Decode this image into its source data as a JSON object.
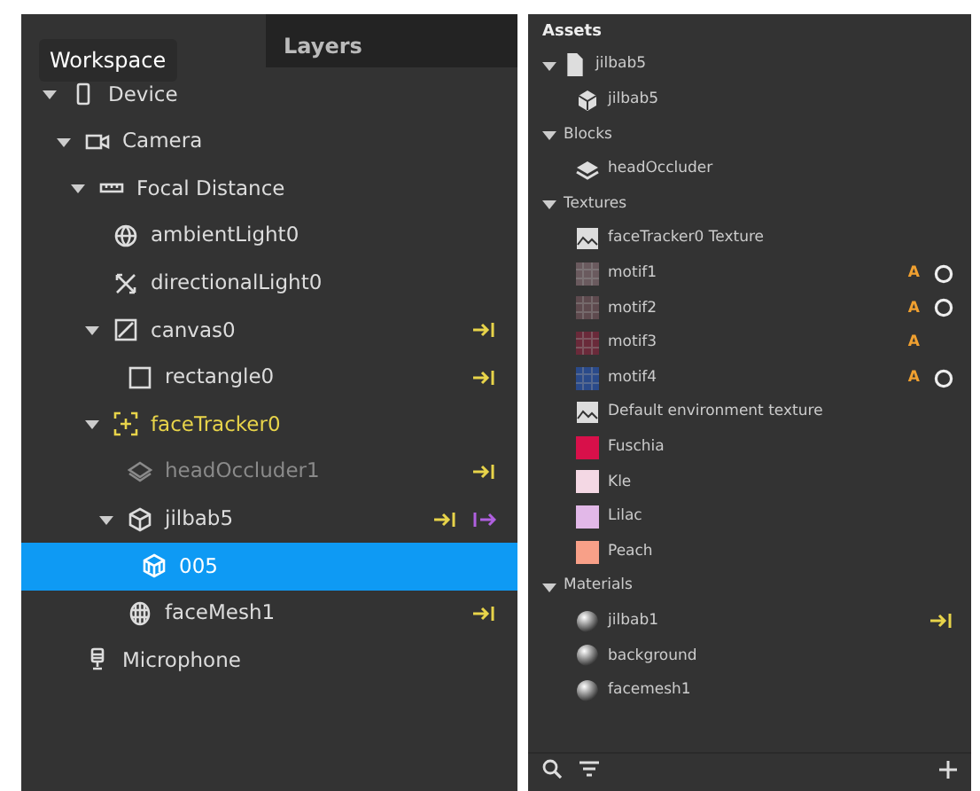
{
  "tooltip": {
    "text": "Workspace"
  },
  "scene_panel": {
    "tabs": [
      {
        "label": "Layers",
        "selected": false
      }
    ],
    "tree": [
      {
        "label": "Device",
        "kind": "device",
        "expanded": true,
        "selected": false,
        "accent": false,
        "dimmed": false,
        "children": [
          {
            "label": "Camera",
            "kind": "camera",
            "expanded": true,
            "selected": false,
            "accent": false,
            "dimmed": false,
            "children": [
              {
                "label": "Focal Distance",
                "kind": "ruler",
                "expanded": true,
                "selected": false,
                "accent": false,
                "dimmed": false,
                "children": [
                  {
                    "label": "ambientLight0",
                    "kind": "globe",
                    "selected": false,
                    "accent": false,
                    "dimmed": false
                  },
                  {
                    "label": "directionalLight0",
                    "kind": "arrows",
                    "selected": false,
                    "accent": false,
                    "dimmed": false
                  },
                  {
                    "label": "canvas0",
                    "kind": "canvas",
                    "expanded": true,
                    "selected": false,
                    "accent": false,
                    "dimmed": false,
                    "link_in": true,
                    "children": [
                      {
                        "label": "rectangle0",
                        "kind": "rectangle",
                        "selected": false,
                        "accent": false,
                        "dimmed": false,
                        "link_in": true
                      }
                    ]
                  },
                  {
                    "label": "faceTracker0",
                    "kind": "tracker",
                    "expanded": true,
                    "selected": false,
                    "accent": true,
                    "dimmed": false,
                    "children": [
                      {
                        "label": "headOccluder1",
                        "kind": "occluder",
                        "selected": false,
                        "accent": false,
                        "dimmed": true,
                        "link_in": true
                      },
                      {
                        "label": "jilbab5",
                        "kind": "object",
                        "expanded": true,
                        "selected": false,
                        "accent": false,
                        "dimmed": false,
                        "link_in": true,
                        "link_out": true,
                        "children": [
                          {
                            "label": "005",
                            "kind": "mesh",
                            "selected": true,
                            "accent": false,
                            "dimmed": false
                          }
                        ]
                      },
                      {
                        "label": "faceMesh1",
                        "kind": "facemesh",
                        "selected": false,
                        "accent": false,
                        "dimmed": false,
                        "link_in": true
                      }
                    ]
                  }
                ]
              }
            ]
          },
          {
            "label": "Microphone",
            "kind": "microphone",
            "selected": false,
            "accent": false,
            "dimmed": false
          }
        ]
      }
    ]
  },
  "assets_panel": {
    "title": "Assets",
    "groups": [
      {
        "label": "jilbab5",
        "kind": "file",
        "expanded": true,
        "items": [
          {
            "label": "jilbab5",
            "kind": "object"
          }
        ]
      },
      {
        "label": "Blocks",
        "kind": "folder",
        "expanded": true,
        "items": [
          {
            "label": "headOccluder",
            "kind": "block"
          }
        ]
      },
      {
        "label": "Textures",
        "kind": "folder",
        "expanded": true,
        "items": [
          {
            "label": "faceTracker0 Texture",
            "kind": "image"
          },
          {
            "label": "motif1",
            "kind": "motif",
            "color": "#6a5a5e",
            "flag": "A",
            "ring": true
          },
          {
            "label": "motif2",
            "kind": "motif",
            "color": "#5e4a4e",
            "flag": "A",
            "ring": true
          },
          {
            "label": "motif3",
            "kind": "motif",
            "color": "#6a2a3a",
            "flag": "A",
            "ring": false
          },
          {
            "label": "motif4",
            "kind": "motif",
            "color": "#2a4a8a",
            "flag": "A",
            "ring": true
          },
          {
            "label": "Default environment texture",
            "kind": "image"
          },
          {
            "label": "Fuschia",
            "kind": "swatch",
            "color": "#d8104a"
          },
          {
            "label": "Kle",
            "kind": "swatch",
            "color": "#f4d8e4"
          },
          {
            "label": "Lilac",
            "kind": "swatch",
            "color": "#e2b8e8"
          },
          {
            "label": "Peach",
            "kind": "swatch",
            "color": "#f8a088"
          }
        ]
      },
      {
        "label": "Materials",
        "kind": "folder",
        "expanded": true,
        "items": [
          {
            "label": "jilbab1",
            "kind": "material",
            "link_in": true
          },
          {
            "label": "background",
            "kind": "material"
          },
          {
            "label": "facemesh1",
            "kind": "material"
          }
        ]
      }
    ]
  }
}
